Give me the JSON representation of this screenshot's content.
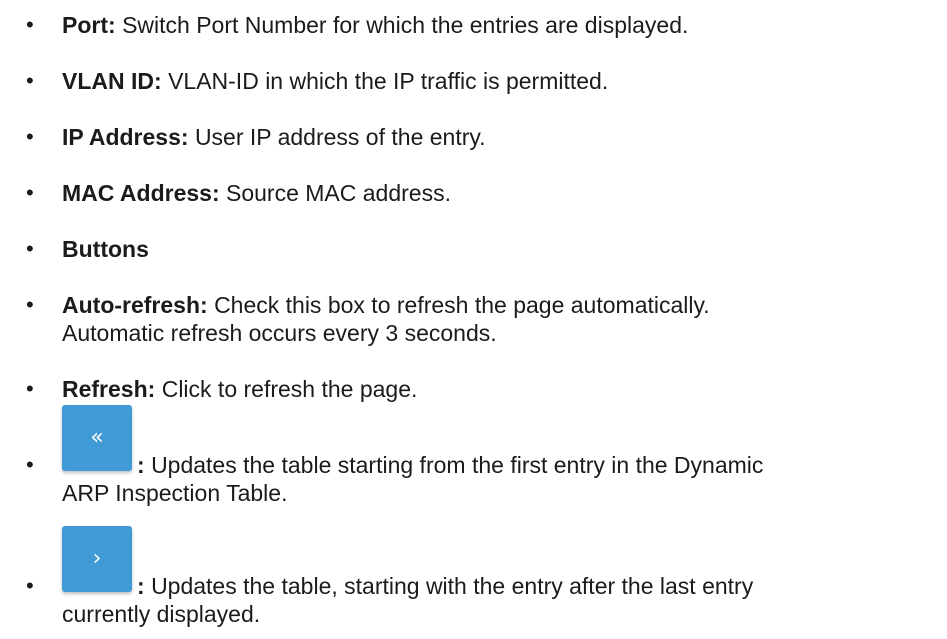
{
  "items": [
    {
      "term": "Port:",
      "desc": "Switch Port Number for which the entries are displayed."
    },
    {
      "term": "VLAN ID:",
      "desc": "VLAN-ID in which the IP traffic is permitted."
    },
    {
      "term": "IP Address:",
      "desc": "User IP address of the entry."
    },
    {
      "term": "MAC Address:",
      "desc": "Source MAC address."
    },
    {
      "term": "Buttons",
      "desc": ""
    },
    {
      "term": "Auto-refresh:",
      "desc": "Check this box to refresh the page automatically.",
      "desc2": "Automatic refresh occurs every 3 seconds."
    },
    {
      "term": "Refresh:",
      "desc": "Click to refresh the page."
    }
  ],
  "first_button": {
    "icon": "«",
    "icon_name": "double-chevron-left-icon",
    "term": ":",
    "desc": "Updates the table starting from the first entry in the Dynamic",
    "desc2": "ARP Inspection Table."
  },
  "next_button": {
    "icon": "›",
    "icon_name": "chevron-right-icon",
    "term": ":",
    "desc": "Updates the table, starting with the entry after the last entry",
    "desc2": "currently displayed."
  },
  "colors": {
    "button_blue": "#3f9ad6",
    "text": "#1b1b1b"
  }
}
